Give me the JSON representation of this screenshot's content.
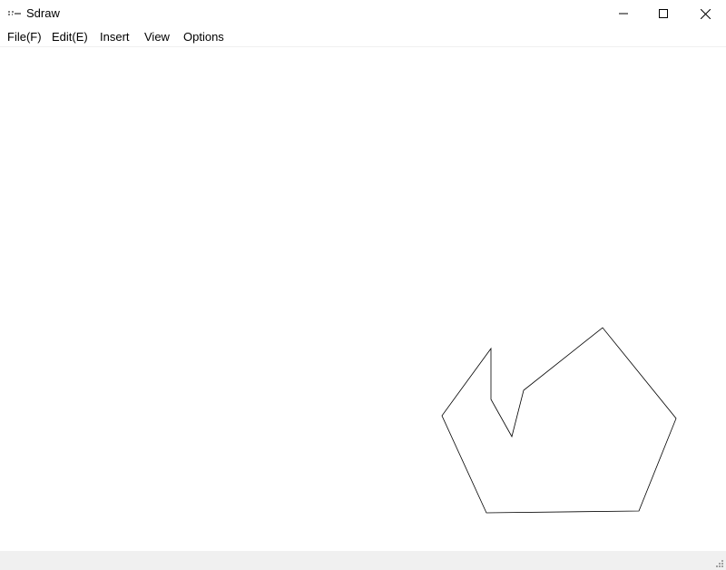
{
  "window": {
    "title": "Sdraw",
    "app_icon": "sdraw-app-icon",
    "controls": {
      "minimize_icon": "minimize-icon",
      "maximize_icon": "maximize-icon",
      "close_icon": "close-icon"
    }
  },
  "menubar": {
    "items": [
      {
        "label": "File(F)"
      },
      {
        "label": "Edit(E)"
      },
      {
        "label": "Insert"
      },
      {
        "label": "View"
      },
      {
        "label": "Options"
      }
    ]
  },
  "canvas": {
    "shape_type": "polygon",
    "stroke_color": "#000000",
    "fill": "none"
  },
  "statusbar": {
    "text": "",
    "grip_icon": "size-grip-icon"
  }
}
